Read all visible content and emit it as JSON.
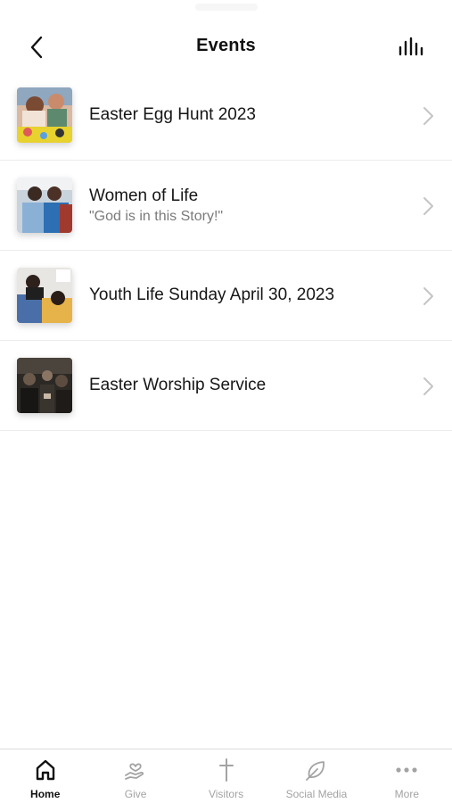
{
  "header": {
    "title": "Events",
    "back_icon": "chevron-left-icon",
    "right_icon": "audio-bars-icon"
  },
  "events": [
    {
      "title": "Easter Egg Hunt 2023",
      "subtitle": "",
      "thumb_icon": "photo-thumbnail"
    },
    {
      "title": "Women of Life",
      "subtitle": "\"God is in this Story!\"",
      "thumb_icon": "photo-thumbnail"
    },
    {
      "title": "Youth Life Sunday April 30, 2023",
      "subtitle": "",
      "thumb_icon": "photo-thumbnail"
    },
    {
      "title": "Easter Worship Service",
      "subtitle": "",
      "thumb_icon": "photo-thumbnail"
    }
  ],
  "tabbar": {
    "items": [
      {
        "label": "Home",
        "icon": "home-icon",
        "active": true
      },
      {
        "label": "Give",
        "icon": "give-hand-heart-icon",
        "active": false
      },
      {
        "label": "Visitors",
        "icon": "cross-icon",
        "active": false
      },
      {
        "label": "Social Media",
        "icon": "leaf-icon",
        "active": false
      },
      {
        "label": "More",
        "icon": "more-dots-icon",
        "active": false
      }
    ]
  },
  "colors": {
    "active_tab": "#111111",
    "inactive_tab": "#a3a3a3",
    "divider": "#ececec",
    "subtitle": "#7a7a7a"
  }
}
